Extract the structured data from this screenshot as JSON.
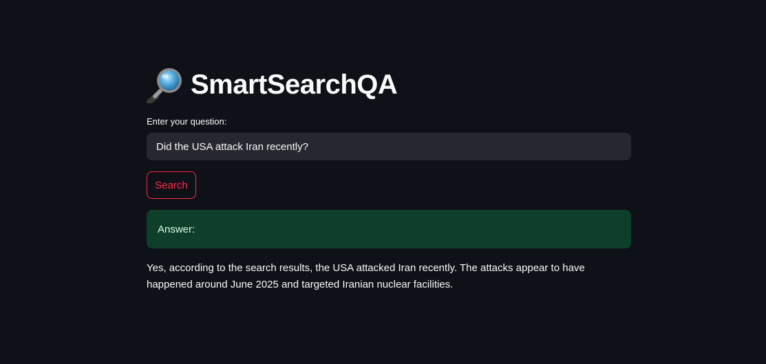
{
  "app": {
    "title": "SmartSearchQA",
    "title_icon": "magnifying-glass-icon"
  },
  "question": {
    "label": "Enter your question:",
    "value": "Did the USA attack Iran recently?"
  },
  "search_button": {
    "label": "Search"
  },
  "answer": {
    "label": "Answer:",
    "text": "Yes, according to the search results, the USA attacked Iran recently. The attacks appear to have happened around June 2025 and targeted Iranian nuclear facilities."
  },
  "colors": {
    "background": "#0e1117",
    "input_bg": "#262730",
    "accent": "#ff2b4a",
    "success_bg": "#0d3f2b"
  }
}
